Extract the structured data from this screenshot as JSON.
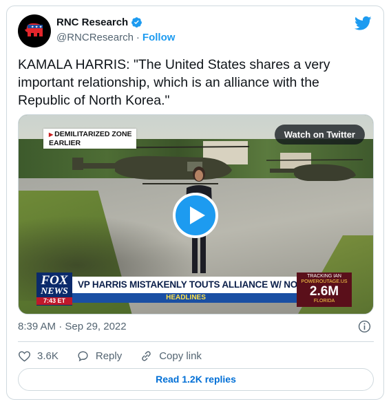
{
  "author": {
    "display_name": "RNC Research",
    "handle": "@RNCResearch",
    "separator": "·",
    "follow_label": "Follow",
    "avatar_icon": "republican-elephant-icon",
    "verified_icon": "verified-badge-icon"
  },
  "brand": {
    "logo_icon": "twitter-bird-icon",
    "accent": "#1d9bf0"
  },
  "tweet": {
    "text": "KAMALA HARRIS: \"The United States shares a very important relationship, which is an alliance with the Republic of North Korea.\""
  },
  "media": {
    "overlay_tag_line1": "DEMILITARIZED ZONE",
    "overlay_tag_line2": "EARLIER",
    "watch_label": "Watch on Twitter",
    "play_icon": "play-icon",
    "network_logo_line1": "FOX",
    "network_logo_line2": "NEWS",
    "network_time": "7:43 ET",
    "chyron": "VP HARRIS MISTAKENLY TOUTS ALLIANCE W/ NORTH KOREA",
    "subbar": "HEADLINES",
    "tracker_line1": "TRACKING IAN",
    "tracker_line2": "POWEROUTAGE.US",
    "tracker_value": "2.6M",
    "tracker_region": "FLORIDA"
  },
  "meta": {
    "timestamp": "8:39 AM · Sep 29, 2022",
    "info_icon": "info-icon"
  },
  "actions": {
    "likes": "3.6K",
    "reply_label": "Reply",
    "copy_link_label": "Copy link"
  },
  "footer": {
    "read_replies_label": "Read 1.2K replies"
  }
}
